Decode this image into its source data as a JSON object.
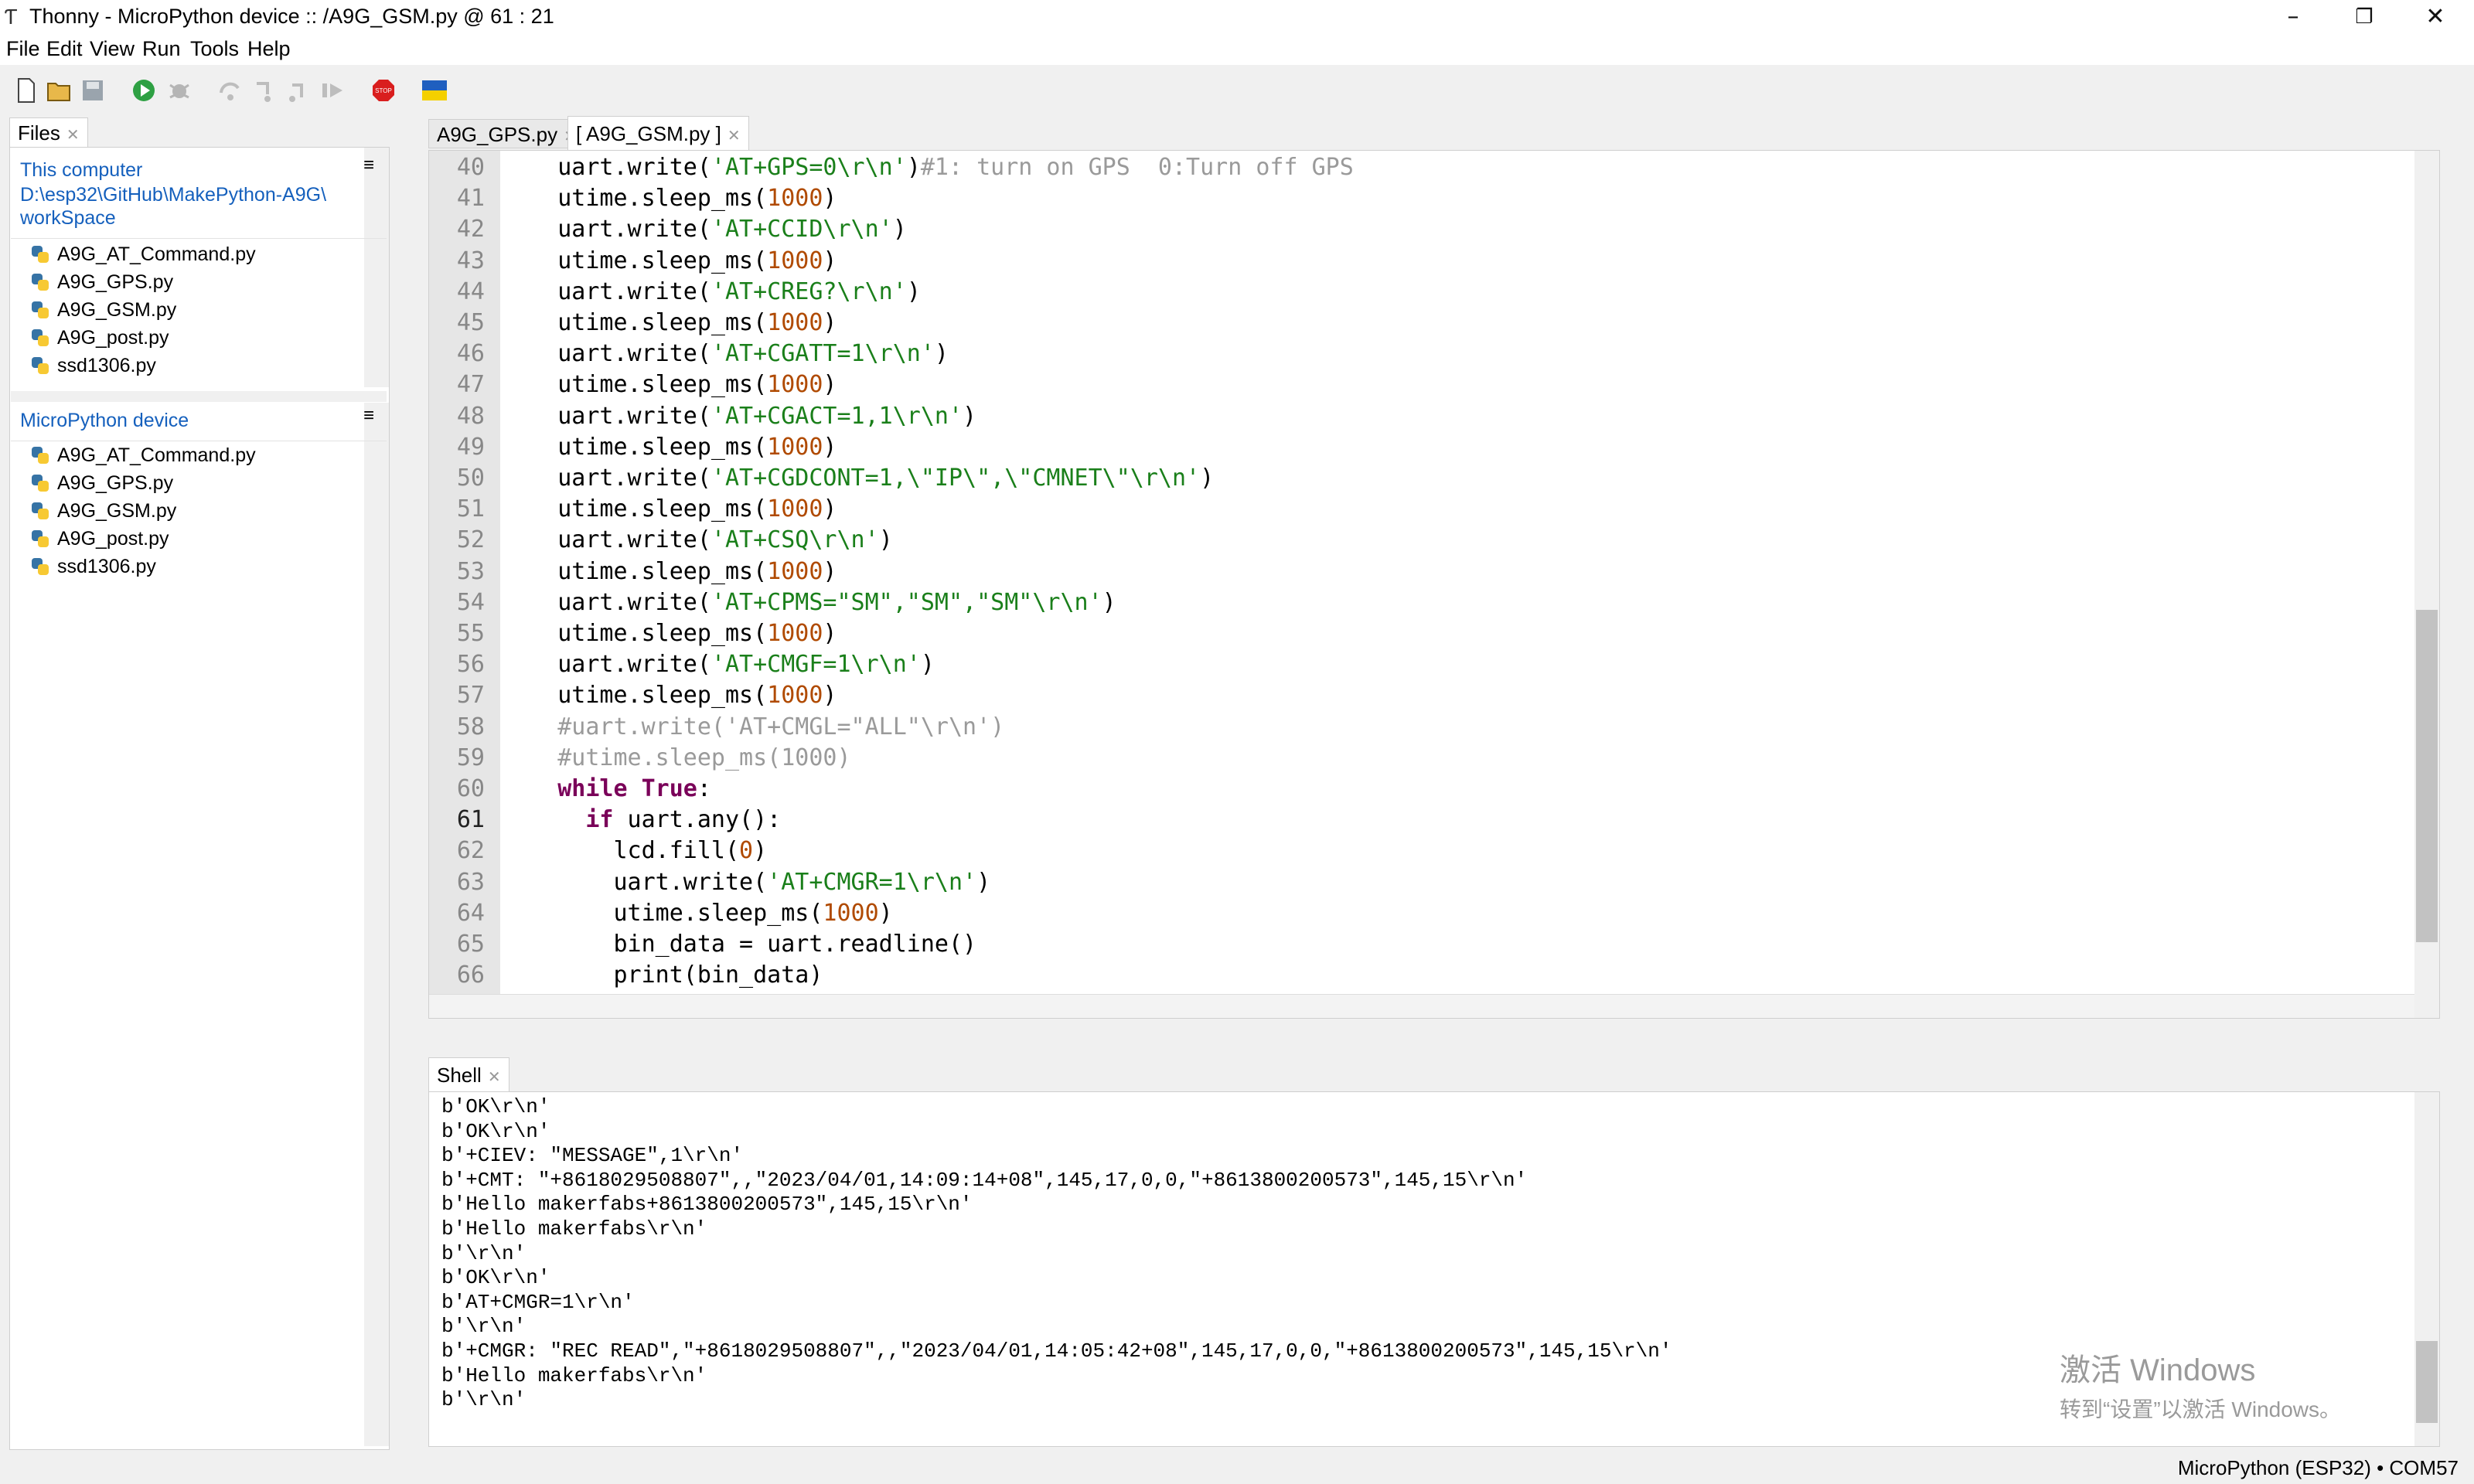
{
  "window": {
    "app_name": "Thonny",
    "title": "Thonny  -  MicroPython device :: /A9G_GSM.py  @  61 : 21"
  },
  "menu": [
    "File",
    "Edit",
    "View",
    "Run",
    "Tools",
    "Help"
  ],
  "files_panel": {
    "tab": "Files",
    "this_computer": {
      "heading": "This computer",
      "path_line1": "D:\\esp32\\GitHub\\MakePython-A9G\\",
      "path_line2": "workSpace",
      "files": [
        "A9G_AT_Command.py",
        "A9G_GPS.py",
        "A9G_GSM.py",
        "A9G_post.py",
        "ssd1306.py"
      ]
    },
    "device": {
      "heading": "MicroPython device",
      "files": [
        "A9G_AT_Command.py",
        "A9G_GPS.py",
        "A9G_GSM.py",
        "A9G_post.py",
        "ssd1306.py"
      ]
    }
  },
  "editor": {
    "tabs": [
      "A9G_GPS.py",
      "[ A9G_GSM.py ]"
    ],
    "active_tab": 1,
    "current_line": 61,
    "lines": [
      {
        "n": "40",
        "text": "    uart.write('AT+GPS=0\\r\\n')#1: turn on GPS  0:Turn off GPS"
      },
      {
        "n": "41",
        "text": "    utime.sleep_ms(1000)"
      },
      {
        "n": "42",
        "text": "    uart.write('AT+CCID\\r\\n')"
      },
      {
        "n": "43",
        "text": "    utime.sleep_ms(1000)"
      },
      {
        "n": "44",
        "text": "    uart.write('AT+CREG?\\r\\n')"
      },
      {
        "n": "45",
        "text": "    utime.sleep_ms(1000)"
      },
      {
        "n": "46",
        "text": "    uart.write('AT+CGATT=1\\r\\n')"
      },
      {
        "n": "47",
        "text": "    utime.sleep_ms(1000)"
      },
      {
        "n": "48",
        "text": "    uart.write('AT+CGACT=1,1\\r\\n')"
      },
      {
        "n": "49",
        "text": "    utime.sleep_ms(1000)"
      },
      {
        "n": "50",
        "text": "    uart.write('AT+CGDCONT=1,\\\"IP\\\",\\\"CMNET\\\"\\r\\n')"
      },
      {
        "n": "51",
        "text": "    utime.sleep_ms(1000)"
      },
      {
        "n": "52",
        "text": "    uart.write('AT+CSQ\\r\\n')"
      },
      {
        "n": "53",
        "text": "    utime.sleep_ms(1000)"
      },
      {
        "n": "54",
        "text": "    uart.write('AT+CPMS=\"SM\",\"SM\",\"SM\"\\r\\n')"
      },
      {
        "n": "55",
        "text": "    utime.sleep_ms(1000)"
      },
      {
        "n": "56",
        "text": "    uart.write('AT+CMGF=1\\r\\n')"
      },
      {
        "n": "57",
        "text": "    utime.sleep_ms(1000)"
      },
      {
        "n": "58",
        "text": "    #uart.write('AT+CMGL=\"ALL\"\\r\\n')"
      },
      {
        "n": "59",
        "text": "    #utime.sleep_ms(1000)"
      },
      {
        "n": "60",
        "text": "    while True:"
      },
      {
        "n": "61",
        "text": "      if uart.any():"
      },
      {
        "n": "62",
        "text": "        lcd.fill(0)"
      },
      {
        "n": "63",
        "text": "        uart.write('AT+CMGR=1\\r\\n')"
      },
      {
        "n": "64",
        "text": "        utime.sleep_ms(1000)"
      },
      {
        "n": "65",
        "text": "        bin_data = uart.readline()"
      },
      {
        "n": "66",
        "text": "        print(bin_data)"
      }
    ]
  },
  "shell": {
    "tab": "Shell",
    "lines": [
      "b'OK\\r\\n'",
      "b'OK\\r\\n'",
      "b'+CIEV: \"MESSAGE\",1\\r\\n'",
      "b'+CMT: \"+8618029508807\",,\"2023/04/01,14:09:14+08\",145,17,0,0,\"+8613800200573\",145,15\\r\\n'",
      "b'Hello makerfabs+8613800200573\",145,15\\r\\n'",
      "b'Hello makerfabs\\r\\n'",
      "b'\\r\\n'",
      "b'OK\\r\\n'",
      "b'AT+CMGR=1\\r\\n'",
      "b'\\r\\n'",
      "b'+CMGR: \"REC READ\",\"+8618029508807\",,\"2023/04/01,14:05:42+08\",145,17,0,0,\"+8613800200573\",145,15\\r\\n'",
      "b'Hello makerfabs\\r\\n'",
      "b'\\r\\n'"
    ]
  },
  "watermark": {
    "line1": "激活 Windows",
    "line2": "转到“设置”以激活 Windows。"
  },
  "status_bar": {
    "text": "MicroPython (ESP32)  •  COM57"
  }
}
